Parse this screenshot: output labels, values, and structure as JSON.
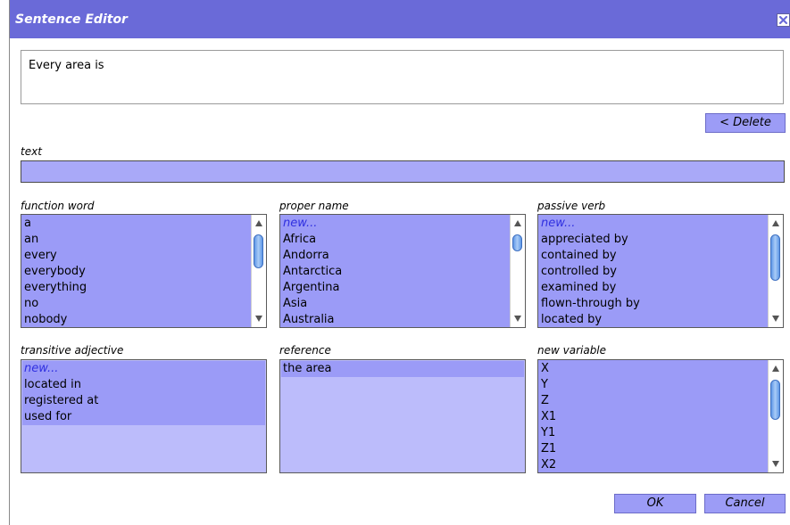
{
  "window": {
    "title": "Sentence Editor"
  },
  "sentence": {
    "text": "Every area is"
  },
  "buttons": {
    "delete": "< Delete",
    "ok": "OK",
    "cancel": "Cancel"
  },
  "text_field": {
    "label": "text",
    "value": ""
  },
  "lists": {
    "function_word": {
      "label": "function word",
      "items": [
        "a",
        "an",
        "every",
        "everybody",
        "everything",
        "no",
        "nobody"
      ]
    },
    "proper_name": {
      "label": "proper name",
      "items": [
        "new...",
        "Africa",
        "Andorra",
        "Antarctica",
        "Argentina",
        "Asia",
        "Australia"
      ]
    },
    "passive_verb": {
      "label": "passive verb",
      "items": [
        "new...",
        "appreciated by",
        "contained by",
        "controlled by",
        "examined by",
        "flown-through by",
        "located by"
      ]
    },
    "transitive_adjective": {
      "label": "transitive adjective",
      "items": [
        "new...",
        "located in",
        "registered at",
        "used for"
      ]
    },
    "reference": {
      "label": "reference",
      "items": [
        "the area"
      ]
    },
    "new_variable": {
      "label": "new variable",
      "items": [
        "X",
        "Y",
        "Z",
        "X1",
        "Y1",
        "Z1",
        "X2"
      ]
    }
  },
  "colors": {
    "titlebar": "#6a6ad8",
    "list_background": "#9b9bf7",
    "list_empty_background": "#bcbcfb",
    "new_item_text": "#3030e0"
  }
}
